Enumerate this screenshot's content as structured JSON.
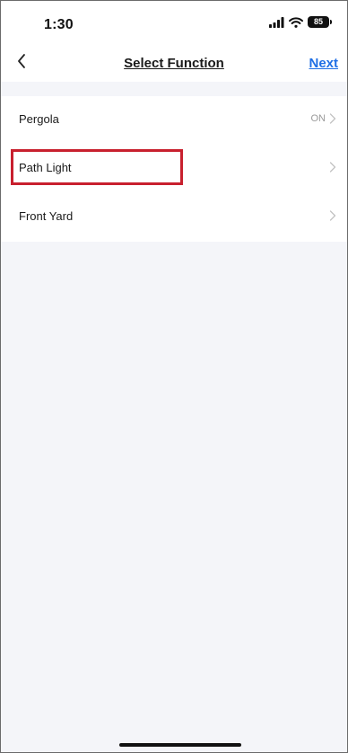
{
  "status_bar": {
    "time": "1:30",
    "battery": "85",
    "icons": [
      "signal-icon",
      "wifi-icon",
      "battery-icon"
    ]
  },
  "nav": {
    "back_icon": "chevron-left-icon",
    "title": "Select Function",
    "next_label": "Next"
  },
  "functions": [
    {
      "label": "Pergola",
      "status": "ON"
    },
    {
      "label": "Path Light",
      "status": ""
    },
    {
      "label": "Front Yard",
      "status": ""
    }
  ],
  "highlighted_item": "Path Light",
  "colors": {
    "accent": "#1f6fe5",
    "highlight": "#c8202e",
    "background": "#f4f5f9"
  }
}
